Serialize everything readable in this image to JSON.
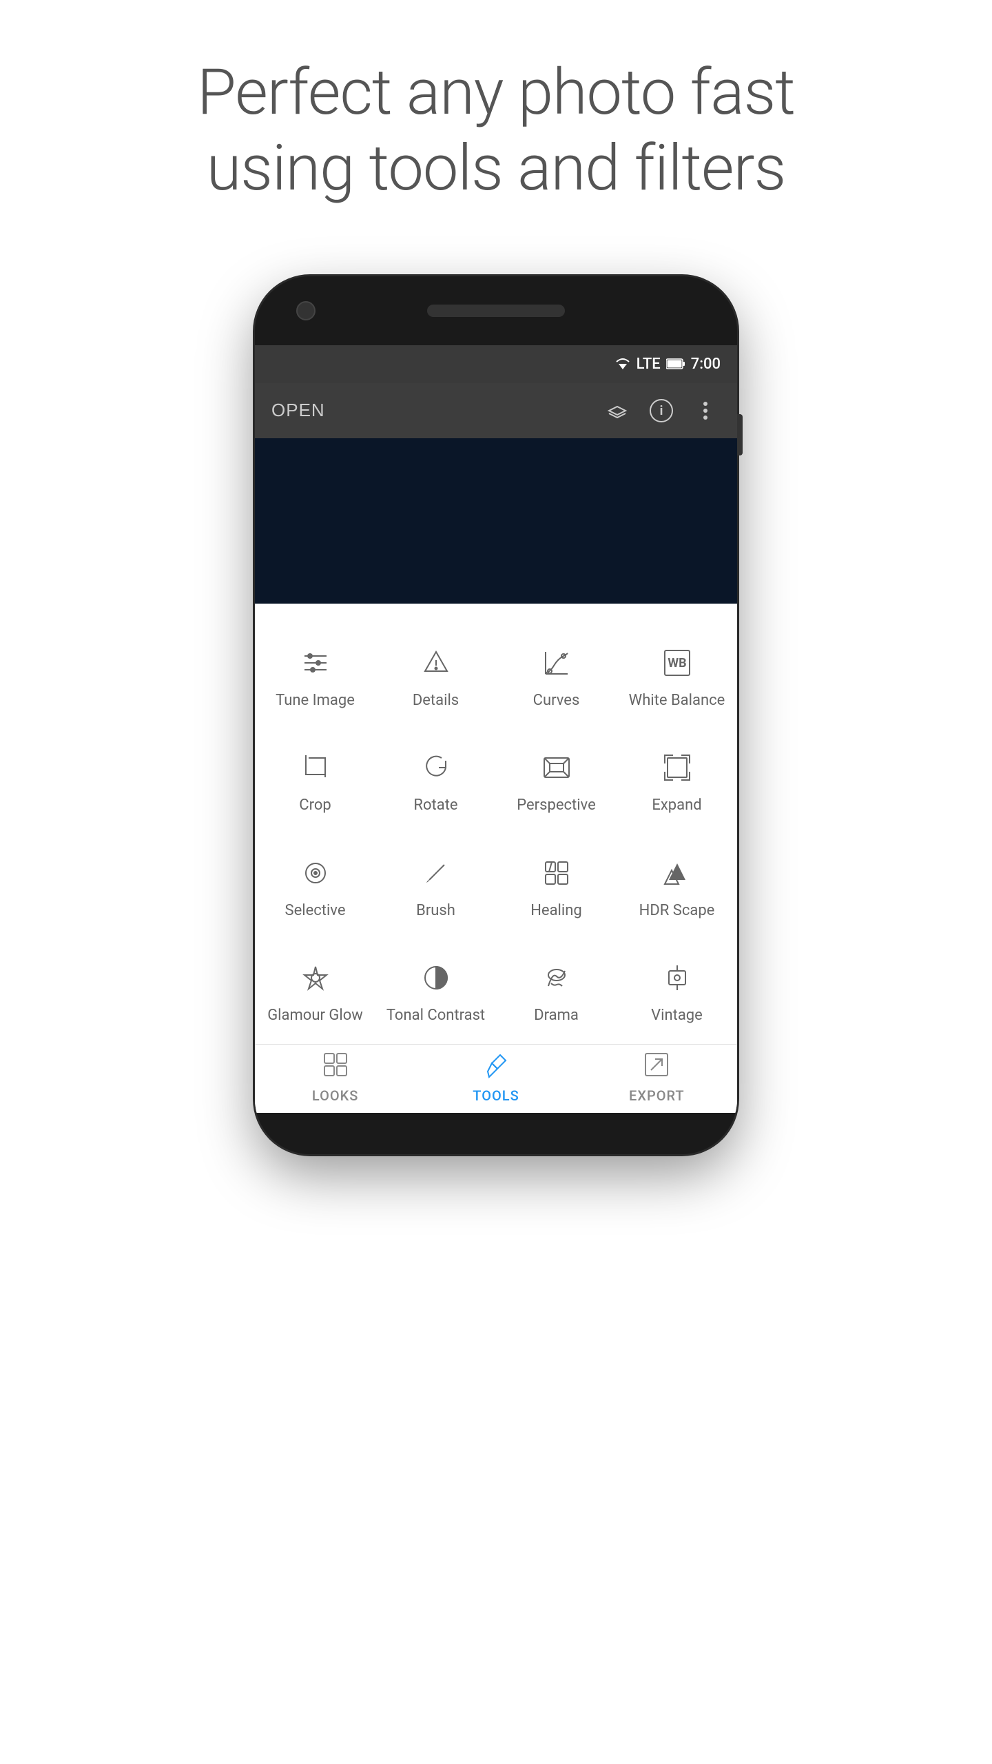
{
  "headline": {
    "line1": "Perfect any photo fast",
    "line2": "using tools and filters"
  },
  "status_bar": {
    "time": "7:00",
    "lte": "LTE"
  },
  "app_bar": {
    "open_label": "OPEN"
  },
  "tools": [
    {
      "id": "tune-image",
      "label": "Tune Image",
      "icon": "tune"
    },
    {
      "id": "details",
      "label": "Details",
      "icon": "details"
    },
    {
      "id": "curves",
      "label": "Curves",
      "icon": "curves"
    },
    {
      "id": "white-balance",
      "label": "White Balance",
      "icon": "wb"
    },
    {
      "id": "crop",
      "label": "Crop",
      "icon": "crop"
    },
    {
      "id": "rotate",
      "label": "Rotate",
      "icon": "rotate"
    },
    {
      "id": "perspective",
      "label": "Perspective",
      "icon": "perspective"
    },
    {
      "id": "expand",
      "label": "Expand",
      "icon": "expand"
    },
    {
      "id": "selective",
      "label": "Selective",
      "icon": "selective"
    },
    {
      "id": "brush",
      "label": "Brush",
      "icon": "brush"
    },
    {
      "id": "healing",
      "label": "Healing",
      "icon": "healing"
    },
    {
      "id": "hdr-scape",
      "label": "HDR Scape",
      "icon": "hdr"
    },
    {
      "id": "glamour-glow",
      "label": "Glamour Glow",
      "icon": "glamour"
    },
    {
      "id": "tonal-contrast",
      "label": "Tonal Contrast",
      "icon": "tonal"
    },
    {
      "id": "drama",
      "label": "Drama",
      "icon": "drama"
    },
    {
      "id": "vintage",
      "label": "Vintage",
      "icon": "vintage"
    }
  ],
  "bottom_nav": [
    {
      "id": "looks",
      "label": "LOOKS",
      "active": false
    },
    {
      "id": "tools",
      "label": "TOOLS",
      "active": true
    },
    {
      "id": "export",
      "label": "EXPORT",
      "active": false
    }
  ]
}
